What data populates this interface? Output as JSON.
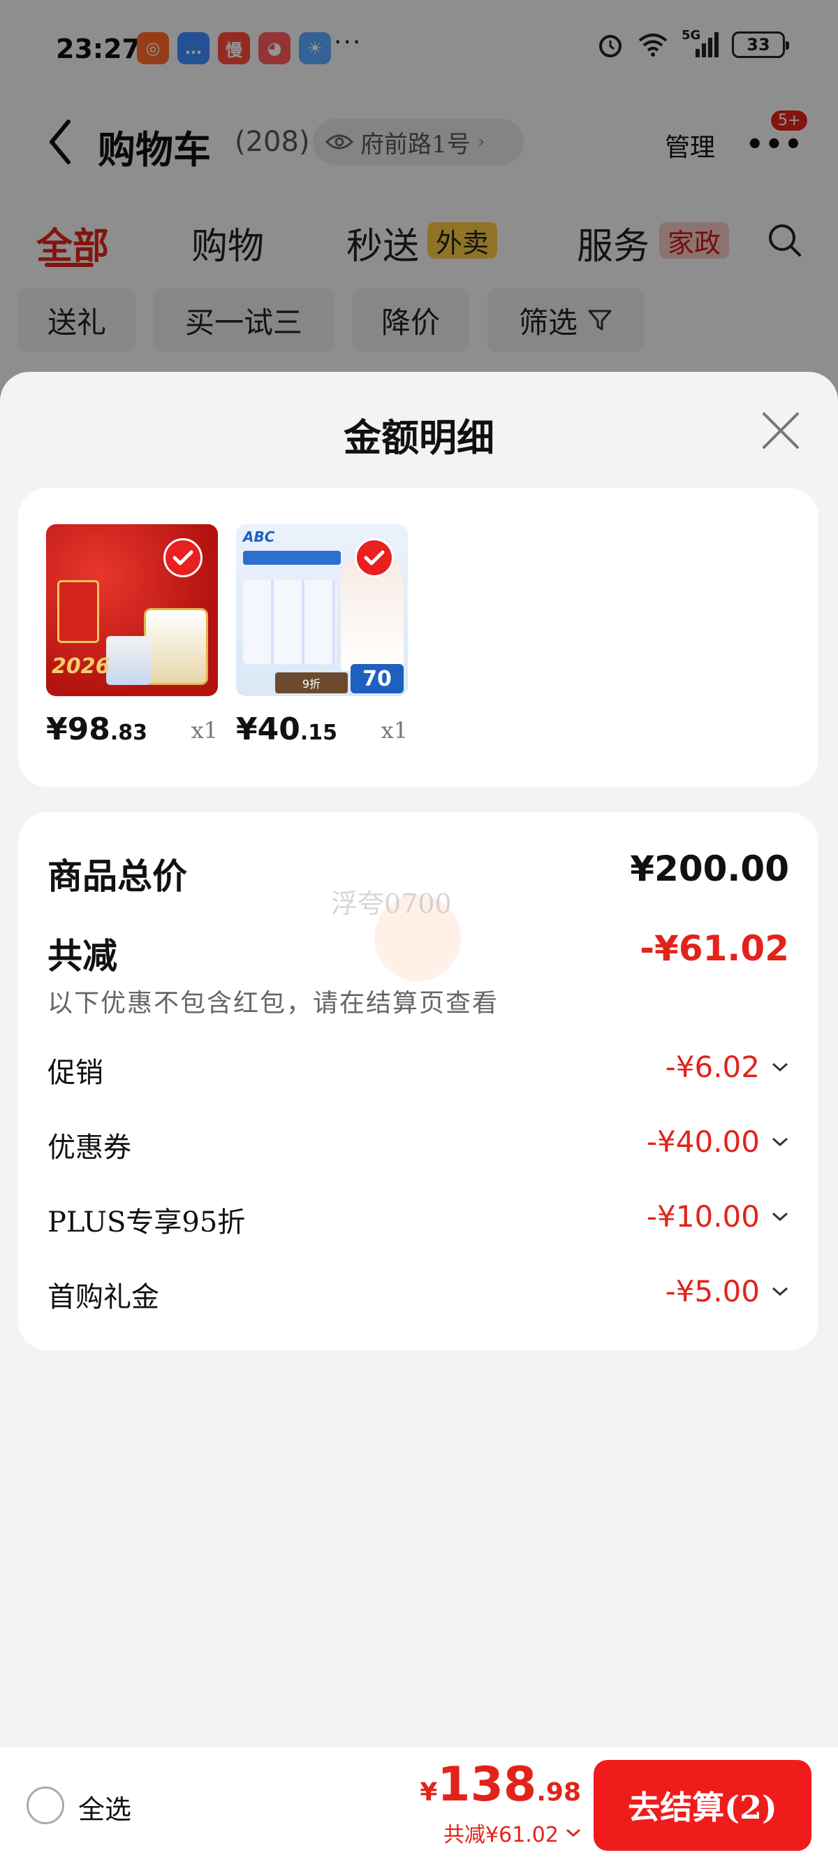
{
  "status_bar": {
    "time": "23:27",
    "more": "···",
    "network": "5G",
    "battery": "33"
  },
  "header": {
    "title": "购物车",
    "count": "(208)",
    "address": "府前路1号",
    "manage": "管理",
    "more_badge": "5+"
  },
  "tabs": [
    {
      "label": "全部"
    },
    {
      "label": "购物"
    },
    {
      "label": "秒送",
      "tag": "外卖"
    },
    {
      "label": "服务",
      "tag": "家政"
    }
  ],
  "filters": [
    "送礼",
    "买一试三",
    "降价",
    "筛选"
  ],
  "sheet": {
    "title": "金额明细",
    "products": [
      {
        "price_int": "¥98",
        "price_dec": ".83",
        "qty": "x1",
        "img_text": "孝心好礼 2026"
      },
      {
        "price_int": "¥40",
        "price_dec": ".15",
        "qty": "x1",
        "img_text": "ABC 0.1cm极薄 70片 下单享9折"
      }
    ],
    "total_label": "商品总价",
    "total_value": "¥200.00",
    "discount_label": "共减",
    "discount_value": "-¥61.02",
    "discount_note": "以下优惠不包含红包，请在结算页查看",
    "items": [
      {
        "label": "促销",
        "value": "-¥6.02"
      },
      {
        "label": "优惠券",
        "value": "-¥40.00"
      },
      {
        "label": "PLUS专享95折",
        "value": "-¥10.00"
      },
      {
        "label": "首购礼金",
        "value": "-¥5.00"
      }
    ],
    "watermark": "浮夸0700"
  },
  "bottom": {
    "select_all": "全选",
    "currency": "¥",
    "price_int": "138",
    "price_dec": ".98",
    "discount": "共减¥61.02",
    "checkout": "去结算(2)"
  },
  "colors": {
    "accent": "#e2231a",
    "checkout": "#f01c1c"
  }
}
